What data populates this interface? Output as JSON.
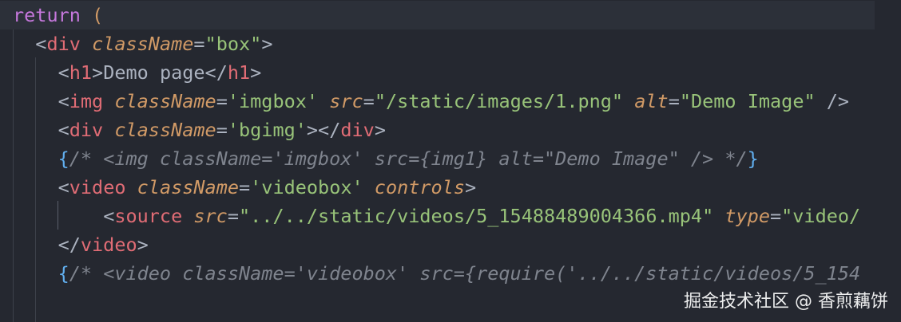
{
  "code": {
    "lines": [
      {
        "tokens": [
          {
            "t": "return ",
            "c": "kw"
          },
          {
            "t": "(",
            "c": "br"
          }
        ]
      },
      {
        "tokens": [
          {
            "t": "  ",
            "c": "txt"
          },
          {
            "t": "<",
            "c": "punc"
          },
          {
            "t": "div",
            "c": "tag"
          },
          {
            "t": " ",
            "c": "txt"
          },
          {
            "t": "className",
            "c": "attr"
          },
          {
            "t": "=",
            "c": "punc"
          },
          {
            "t": "\"box\"",
            "c": "str"
          },
          {
            "t": ">",
            "c": "punc"
          }
        ]
      },
      {
        "tokens": [
          {
            "t": "    ",
            "c": "txt"
          },
          {
            "t": "<",
            "c": "punc"
          },
          {
            "t": "h1",
            "c": "tag"
          },
          {
            "t": ">",
            "c": "punc"
          },
          {
            "t": "Demo page",
            "c": "txt"
          },
          {
            "t": "</",
            "c": "punc"
          },
          {
            "t": "h1",
            "c": "tag"
          },
          {
            "t": ">",
            "c": "punc"
          }
        ]
      },
      {
        "tokens": [
          {
            "t": "    ",
            "c": "txt"
          },
          {
            "t": "<",
            "c": "punc"
          },
          {
            "t": "img",
            "c": "tag"
          },
          {
            "t": " ",
            "c": "txt"
          },
          {
            "t": "className",
            "c": "attr"
          },
          {
            "t": "=",
            "c": "punc"
          },
          {
            "t": "'imgbox'",
            "c": "str"
          },
          {
            "t": " ",
            "c": "txt"
          },
          {
            "t": "src",
            "c": "attr"
          },
          {
            "t": "=",
            "c": "punc"
          },
          {
            "t": "\"/static/images/1.png\"",
            "c": "str"
          },
          {
            "t": " ",
            "c": "txt"
          },
          {
            "t": "alt",
            "c": "attr"
          },
          {
            "t": "=",
            "c": "punc"
          },
          {
            "t": "\"Demo Image\"",
            "c": "str"
          },
          {
            "t": " />",
            "c": "punc"
          }
        ]
      },
      {
        "tokens": [
          {
            "t": "    ",
            "c": "txt"
          },
          {
            "t": "<",
            "c": "punc"
          },
          {
            "t": "div",
            "c": "tag"
          },
          {
            "t": " ",
            "c": "txt"
          },
          {
            "t": "className",
            "c": "attr"
          },
          {
            "t": "=",
            "c": "punc"
          },
          {
            "t": "'bgimg'",
            "c": "str"
          },
          {
            "t": "></",
            "c": "punc"
          },
          {
            "t": "div",
            "c": "tag"
          },
          {
            "t": ">",
            "c": "punc"
          }
        ]
      },
      {
        "tokens": [
          {
            "t": "    ",
            "c": "txt"
          },
          {
            "t": "{",
            "c": "cbr"
          },
          {
            "t": "/* <img className='imgbox' src={img1} alt=\"Demo Image\" /> */",
            "c": "cm"
          },
          {
            "t": "}",
            "c": "cbr"
          }
        ]
      },
      {
        "tokens": [
          {
            "t": "    ",
            "c": "txt"
          },
          {
            "t": "<",
            "c": "punc"
          },
          {
            "t": "video",
            "c": "tag"
          },
          {
            "t": " ",
            "c": "txt"
          },
          {
            "t": "className",
            "c": "attr"
          },
          {
            "t": "=",
            "c": "punc"
          },
          {
            "t": "'videobox'",
            "c": "str"
          },
          {
            "t": " ",
            "c": "txt"
          },
          {
            "t": "controls",
            "c": "attr"
          },
          {
            "t": ">",
            "c": "punc"
          }
        ]
      },
      {
        "tokens": [
          {
            "t": "        ",
            "c": "txt"
          },
          {
            "t": "<",
            "c": "punc"
          },
          {
            "t": "source",
            "c": "tag"
          },
          {
            "t": " ",
            "c": "txt"
          },
          {
            "t": "src",
            "c": "attr"
          },
          {
            "t": "=",
            "c": "punc"
          },
          {
            "t": "\"../../static/videos/5_15488489004366.mp4\"",
            "c": "str"
          },
          {
            "t": " ",
            "c": "txt"
          },
          {
            "t": "type",
            "c": "attr"
          },
          {
            "t": "=",
            "c": "punc"
          },
          {
            "t": "\"video/",
            "c": "str"
          }
        ]
      },
      {
        "tokens": [
          {
            "t": "    ",
            "c": "txt"
          },
          {
            "t": "</",
            "c": "punc"
          },
          {
            "t": "video",
            "c": "tag"
          },
          {
            "t": ">",
            "c": "punc"
          }
        ]
      },
      {
        "tokens": [
          {
            "t": "    ",
            "c": "txt"
          },
          {
            "t": "{",
            "c": "cbr"
          },
          {
            "t": "/* <video className='videobox' src={require('../../static/videos/5_154",
            "c": "cm"
          }
        ]
      }
    ]
  },
  "watermark": "掘金技术社区 @ 香煎藕饼",
  "colors": {
    "background": "#252830",
    "keyword": "#c678dd",
    "tag": "#e06c75",
    "attribute": "#d19a66",
    "string": "#98c379",
    "comment": "#7f848e",
    "brace": "#61afef",
    "text": "#abb2bf"
  }
}
